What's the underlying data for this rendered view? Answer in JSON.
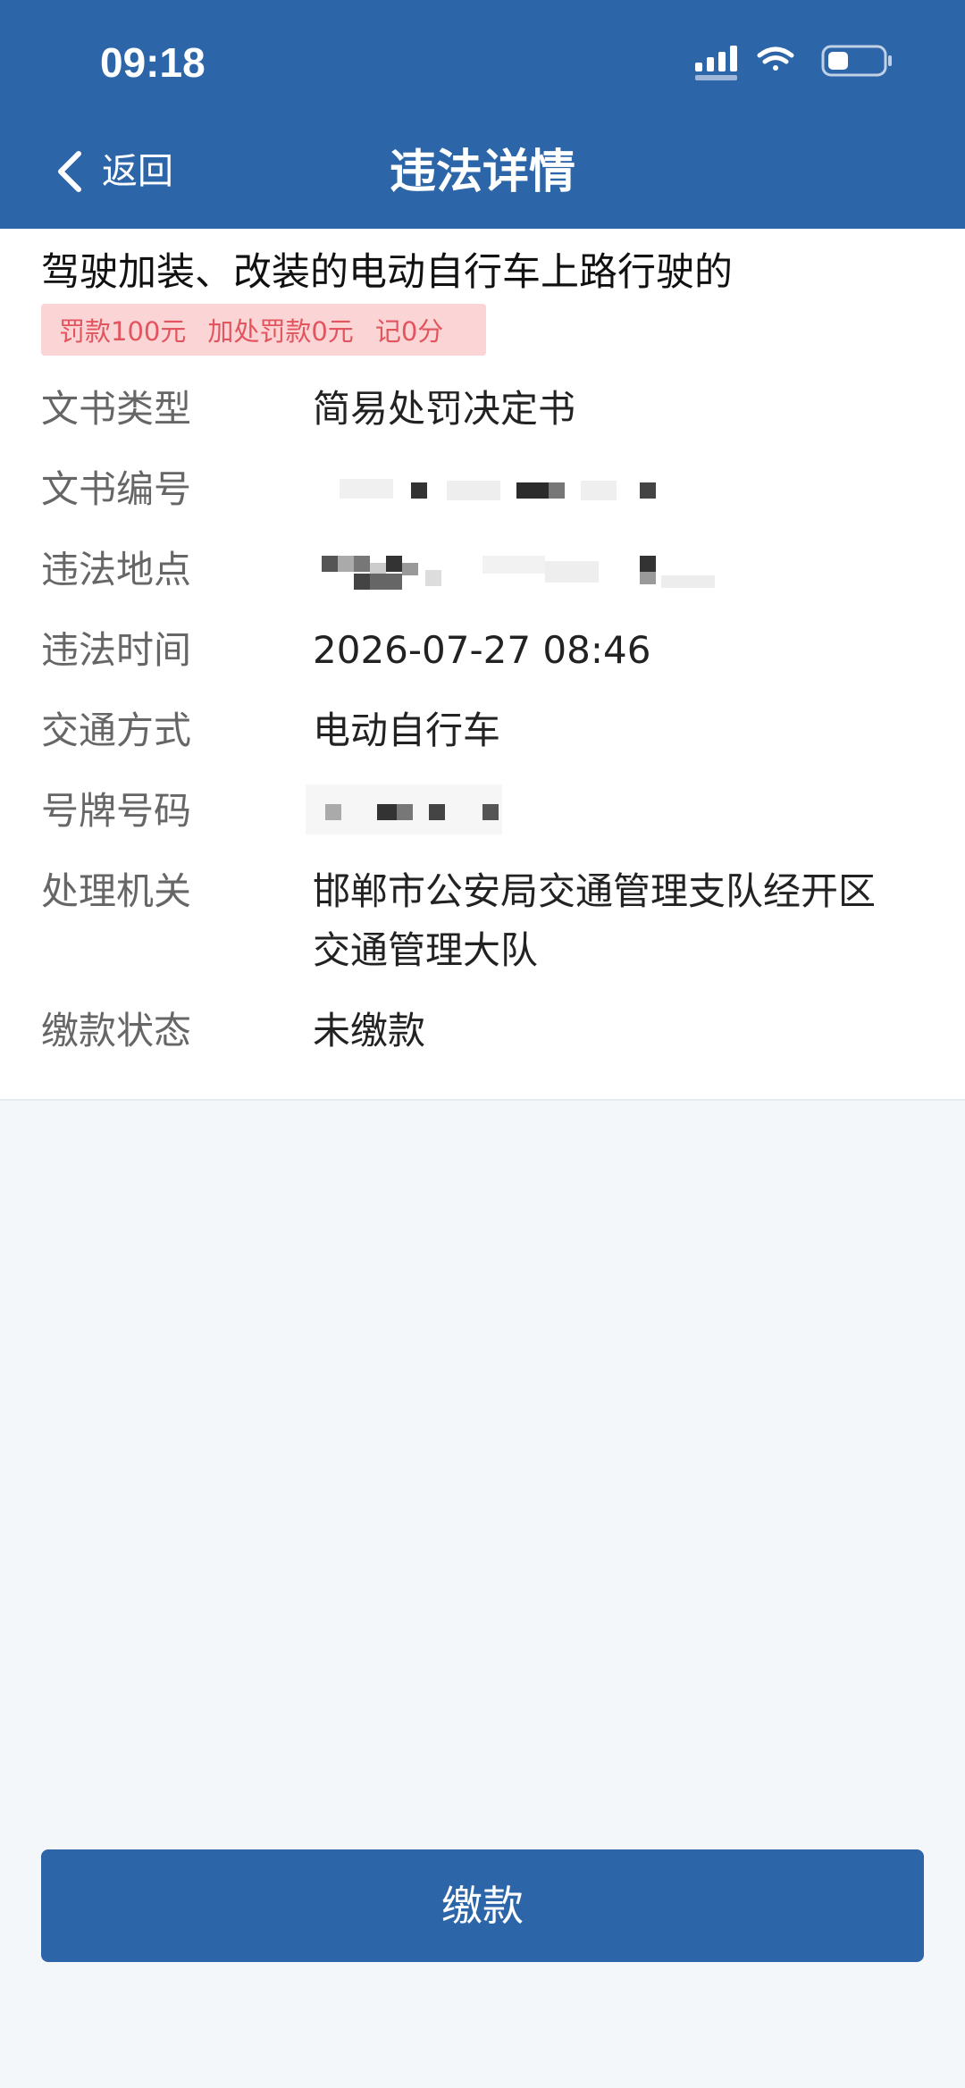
{
  "status_bar": {
    "time": "09:18",
    "icons": [
      "signal-icon",
      "wifi-icon",
      "battery-icon"
    ]
  },
  "nav": {
    "back_label": "返回",
    "title": "违法详情"
  },
  "violation": {
    "title": "驾驶加装、改装的电动自行车上路行驶的",
    "tags": [
      "罚款100元",
      "加处罚款0元",
      "记0分"
    ]
  },
  "details": [
    {
      "label": "文书类型",
      "value": "简易处罚决定书"
    },
    {
      "label": "文书编号",
      "value": ""
    },
    {
      "label": "违法地点",
      "value": ""
    },
    {
      "label": "违法时间",
      "value": "2026-07-27 08:46"
    },
    {
      "label": "交通方式",
      "value": "电动自行车"
    },
    {
      "label": "号牌号码",
      "value": ""
    },
    {
      "label": "处理机关",
      "value": "邯郸市公安局交通管理支队经开区交通管理大队"
    },
    {
      "label": "缴款状态",
      "value": "未缴款"
    }
  ],
  "pay_button_label": "缴款",
  "colors": {
    "brand": "#2d65a9",
    "tag_bg": "#fbd4d6",
    "tag_text": "#e2555e",
    "page_bg": "#f4f7f9"
  }
}
